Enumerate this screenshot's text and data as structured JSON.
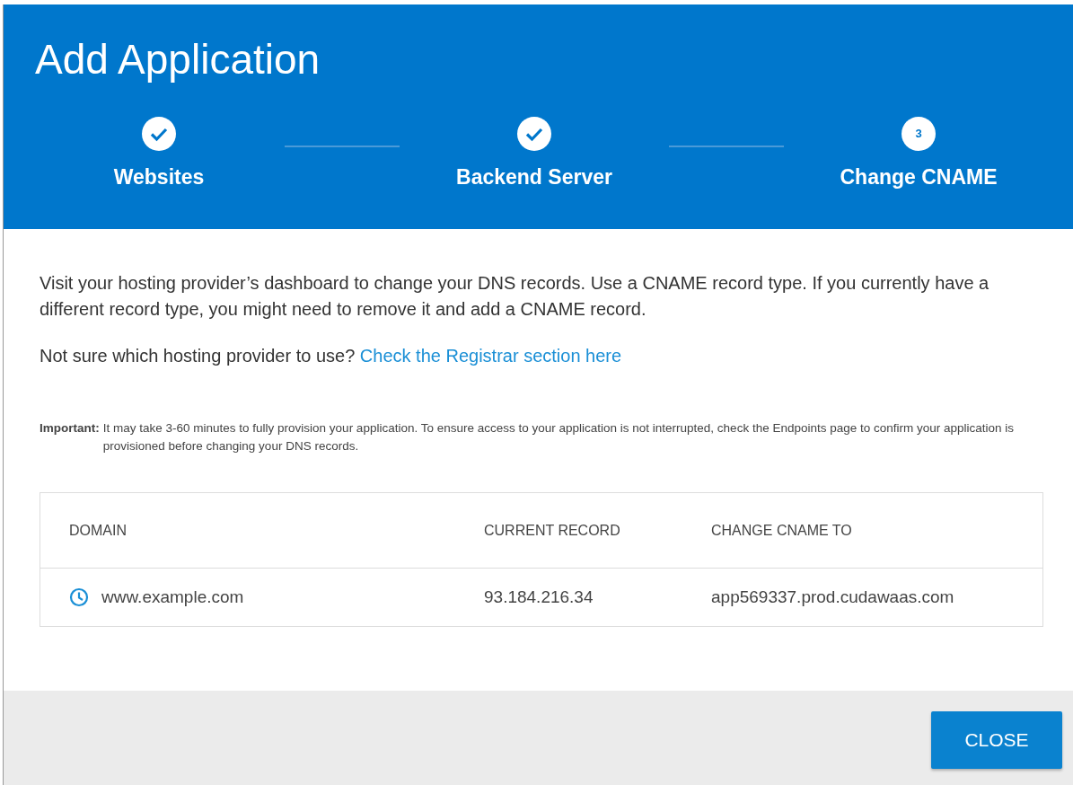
{
  "dialog": {
    "title": "Add Application"
  },
  "steps": [
    {
      "label": "Websites",
      "done": true
    },
    {
      "label": "Backend Server",
      "done": true
    },
    {
      "label": "Change CNAME",
      "done": false,
      "number": "3"
    }
  ],
  "intro": "Visit your hosting provider’s dashboard to change your DNS records. Use a CNAME record type. If you currently have a different record type, you might need to remove it and add a CNAME record.",
  "registrar": {
    "question": "Not sure which hosting provider to use?",
    "link": "Check the Registrar section here"
  },
  "important": {
    "label": "Important:",
    "text": "It may take 3-60 minutes to fully provision your application. To ensure access to your application is not interrupted, check the Endpoints page to confirm your application is provisioned before changing your DNS records."
  },
  "table": {
    "columns": [
      "DOMAIN",
      "CURRENT RECORD",
      "CHANGE CNAME TO"
    ],
    "rows": [
      {
        "pending": true,
        "domain": "www.example.com",
        "current_record": "93.184.216.34",
        "change_to": "app569337.prod.cudawaas.com"
      }
    ]
  },
  "footer": {
    "button": "CLOSE"
  }
}
